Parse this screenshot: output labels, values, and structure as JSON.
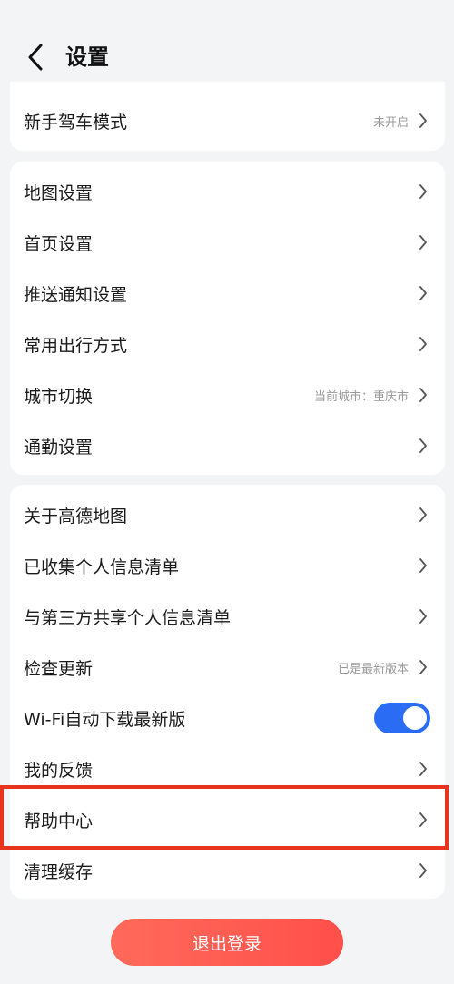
{
  "header": {
    "title": "设置",
    "back_icon": "chevron-left-icon"
  },
  "group1": {
    "items": [
      {
        "label": "新手驾车模式",
        "value": "未开启"
      }
    ]
  },
  "group2": {
    "items": [
      {
        "label": "地图设置"
      },
      {
        "label": "首页设置"
      },
      {
        "label": "推送通知设置"
      },
      {
        "label": "常用出行方式"
      },
      {
        "label": "城市切换",
        "value": "当前城市：重庆市"
      },
      {
        "label": "通勤设置"
      }
    ]
  },
  "group3": {
    "items": [
      {
        "label": "关于高德地图"
      },
      {
        "label": "已收集个人信息清单"
      },
      {
        "label": "与第三方共享个人信息清单"
      },
      {
        "label": "检查更新",
        "value": "已是最新版本"
      },
      {
        "label": "Wi-Fi自动下载最新版",
        "toggle": true
      },
      {
        "label": "我的反馈"
      },
      {
        "label": "帮助中心"
      },
      {
        "label": "清理缓存"
      }
    ]
  },
  "logout": {
    "label": "退出登录"
  },
  "colors": {
    "background": "#f3f4f6",
    "card": "#ffffff",
    "toggle_on": "#2a6df4",
    "highlight": "#e8341c",
    "logout_start": "#ff6a5a",
    "logout_end": "#ff4f4a"
  }
}
